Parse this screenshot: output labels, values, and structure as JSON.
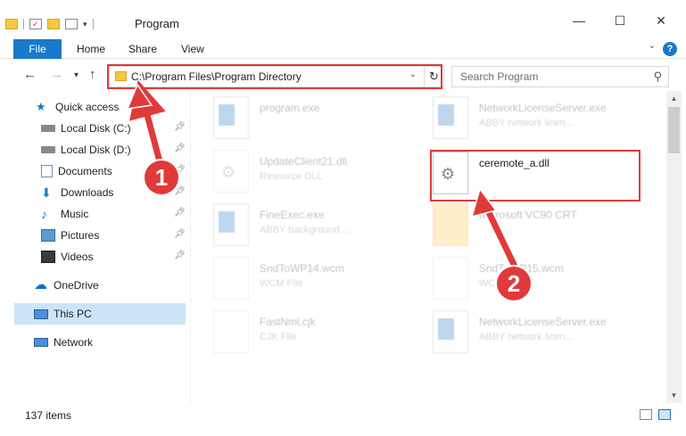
{
  "window": {
    "title": "Program",
    "minimize": "—",
    "maximize": "☐",
    "close": "✕"
  },
  "ribbon": {
    "file": "File",
    "tabs": [
      "Home",
      "Share",
      "View"
    ],
    "help": "?"
  },
  "navigation": {
    "back": "←",
    "forward": "→",
    "recent": "▾",
    "up": "↑",
    "address": "C:\\Program Files\\Program Directory",
    "search_placeholder": "Search Program"
  },
  "sidebar": {
    "items": [
      {
        "label": "Quick access",
        "icon": "star-icon",
        "pinned": false
      },
      {
        "label": "Local Disk (C:)",
        "icon": "drive-icon",
        "pinned": true
      },
      {
        "label": "Local Disk (D:)",
        "icon": "drive-icon",
        "pinned": true
      },
      {
        "label": "Documents",
        "icon": "documents-icon",
        "pinned": true
      },
      {
        "label": "Downloads",
        "icon": "download-icon",
        "pinned": true
      },
      {
        "label": "Music",
        "icon": "music-icon",
        "pinned": true
      },
      {
        "label": "Pictures",
        "icon": "pictures-icon",
        "pinned": true
      },
      {
        "label": "Videos",
        "icon": "videos-icon",
        "pinned": true
      },
      {
        "label": "OneDrive",
        "icon": "cloud-icon",
        "pinned": false
      },
      {
        "label": "This PC",
        "icon": "computer-icon",
        "pinned": false,
        "selected": true
      },
      {
        "label": "Network",
        "icon": "network-icon",
        "pinned": false
      }
    ]
  },
  "files": [
    {
      "name": "program.exe",
      "type": ""
    },
    {
      "name": "NetworkLicenseServer.exe",
      "type": "ABBY network licen..."
    },
    {
      "name": "UpdateClient21.dll",
      "type": "Resource DLL"
    },
    {
      "name": "ceremote_a.dll",
      "type": ""
    },
    {
      "name": "FineExec.exe",
      "type": "ABBY background ..."
    },
    {
      "name": "Microsoft VC90 CRT",
      "type": ""
    },
    {
      "name": "SndToWP14.wcm",
      "type": "WCM File"
    },
    {
      "name": "SndToWP15.wcm",
      "type": "WCM File"
    },
    {
      "name": "FastNml.cjk",
      "type": "CJK File"
    },
    {
      "name": "NetworkLicenseServer.exe",
      "type": "ABBY network licen..."
    }
  ],
  "status": {
    "item_count": "137 items"
  },
  "annotations": {
    "step1": "1",
    "step2": "2",
    "highlight_color": "#e03a3a"
  },
  "colors": {
    "accent": "#1979ca",
    "selection": "#cce4f7"
  }
}
